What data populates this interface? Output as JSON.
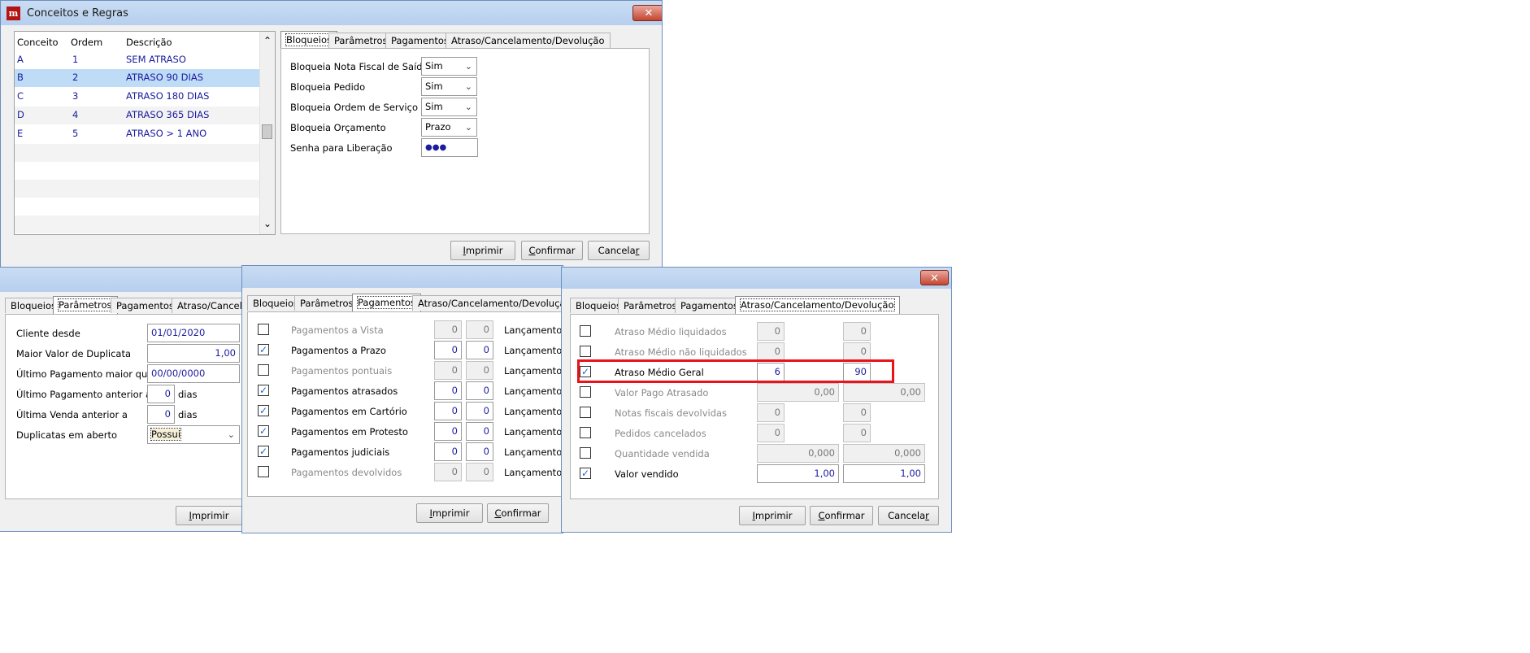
{
  "main_window": {
    "title": "Conceitos e Regras",
    "close_glyph": "✕",
    "app_icon_glyph": "m",
    "grid": {
      "headers": [
        "Conceito",
        "Ordem",
        "Descrição"
      ],
      "rows": [
        {
          "conceito": "A",
          "ordem": "1",
          "descricao": "SEM ATRASO"
        },
        {
          "conceito": "B",
          "ordem": "2",
          "descricao": "ATRASO 90 DIAS"
        },
        {
          "conceito": "C",
          "ordem": "3",
          "descricao": "ATRASO 180 DIAS"
        },
        {
          "conceito": "D",
          "ordem": "4",
          "descricao": "ATRASO 365 DIAS"
        },
        {
          "conceito": "E",
          "ordem": "5",
          "descricao": "ATRASO > 1 ANO"
        }
      ],
      "selected_row": "B",
      "scroll_up": "⌃",
      "scroll_down": "⌄"
    },
    "tabs": [
      "Bloqueios",
      "Parâmetros",
      "Pagamentos",
      "Atraso/Cancelamento/Devolução"
    ],
    "bloqueios": {
      "nota_fiscal_label": "Bloqueia Nota Fiscal de Saída",
      "nota_fiscal_value": "Sim",
      "pedido_label": "Bloqueia Pedido",
      "pedido_value": "Sim",
      "ordem_servico_label": "Bloqueia Ordem de Serviço",
      "ordem_servico_value": "Sim",
      "orcamento_label": "Bloqueia Orçamento",
      "orcamento_value": "Prazo",
      "senha_label": "Senha para Liberação",
      "senha_value": "●●●"
    },
    "buttons": {
      "imprimir_u": "I",
      "imprimir_rest": "mprimir",
      "confirmar_u": "C",
      "confirmar_rest": "onfirmar",
      "cancelar_pre": "Cancela",
      "cancelar_u": "r"
    }
  },
  "parametros_window": {
    "tabs": [
      "Bloqueios",
      "Parâmetros",
      "Pagamentos",
      "Atraso/Cancelar"
    ],
    "cliente_desde_label": "Cliente desde",
    "cliente_desde_value": "01/01/2020",
    "maior_valor_label": "Maior Valor de Duplicata",
    "maior_valor_value": "1,00",
    "ultimo_pag_maior_label": "Último Pagamento maior que",
    "ultimo_pag_maior_value": "00/00/0000",
    "ultimo_pag_anterior_label": "Último Pagamento anterior a",
    "ultimo_pag_anterior_value": "0",
    "ultimo_pag_anterior_unit": "dias",
    "ultima_venda_label": "Última Venda anterior a",
    "ultima_venda_value": "0",
    "ultima_venda_unit": "dias",
    "duplicatas_label": "Duplicatas em aberto",
    "duplicatas_value": "Possui",
    "imprimir_u": "I",
    "imprimir_rest": "mprimir"
  },
  "pagamentos_window": {
    "tabs": [
      "Bloqueios",
      "Parâmetros",
      "Pagamentos",
      "Atraso/Cancelamento/Devolução"
    ],
    "suffix": "Lançamentos",
    "rows": [
      {
        "label": "Pagamentos a Vista",
        "checked": false,
        "v1": "0",
        "v2": "0",
        "disabled": true
      },
      {
        "label": "Pagamentos a Prazo",
        "checked": true,
        "v1": "0",
        "v2": "0",
        "disabled": false
      },
      {
        "label": "Pagamentos pontuais",
        "checked": false,
        "v1": "0",
        "v2": "0",
        "disabled": true
      },
      {
        "label": "Pagamentos atrasados",
        "checked": true,
        "v1": "0",
        "v2": "0",
        "disabled": false
      },
      {
        "label": "Pagamentos em Cartório",
        "checked": true,
        "v1": "0",
        "v2": "0",
        "disabled": false
      },
      {
        "label": "Pagamentos em Protesto",
        "checked": true,
        "v1": "0",
        "v2": "0",
        "disabled": false
      },
      {
        "label": "Pagamentos judiciais",
        "checked": true,
        "v1": "0",
        "v2": "0",
        "disabled": false
      },
      {
        "label": "Pagamentos devolvidos",
        "checked": false,
        "v1": "0",
        "v2": "0",
        "disabled": true
      }
    ],
    "imprimir_u": "I",
    "imprimir_rest": "mprimir",
    "confirmar_u": "C",
    "confirmar_rest": "onfirmar"
  },
  "atraso_window": {
    "close_glyph": "✕",
    "tabs": [
      "Bloqueios",
      "Parâmetros",
      "Pagamentos",
      "Atraso/Cancelamento/Devolução"
    ],
    "rows": [
      {
        "label": "Atraso Médio liquidados",
        "checked": false,
        "v1": "0",
        "v2": "0",
        "disabled": true
      },
      {
        "label": "Atraso Médio não liquidados",
        "checked": false,
        "v1": "0",
        "v2": "0",
        "disabled": true
      },
      {
        "label": "Atraso Médio Geral",
        "checked": true,
        "v1": "6",
        "v2": "90",
        "disabled": false
      },
      {
        "label": "Valor Pago Atrasado",
        "checked": false,
        "v1": "0,00",
        "v2": "0,00",
        "disabled": true
      },
      {
        "label": "Notas fiscais devolvidas",
        "checked": false,
        "v1": "0",
        "v2": "0",
        "disabled": true
      },
      {
        "label": "Pedidos cancelados",
        "checked": false,
        "v1": "0",
        "v2": "0",
        "disabled": true
      },
      {
        "label": "Quantidade vendida",
        "checked": false,
        "v1": "0,000",
        "v2": "0,000",
        "disabled": true
      },
      {
        "label": "Valor vendido",
        "checked": true,
        "v1": "1,00",
        "v2": "1,00",
        "disabled": false
      }
    ],
    "highlight_color": "#e8131b",
    "buttons": {
      "imprimir_u": "I",
      "imprimir_rest": "mprimir",
      "confirmar_u": "C",
      "confirmar_rest": "onfirmar",
      "cancelar_pre": "Cancela",
      "cancelar_u": "r"
    }
  },
  "check_glyph": "✓",
  "dropdown_glyph": "⌄"
}
